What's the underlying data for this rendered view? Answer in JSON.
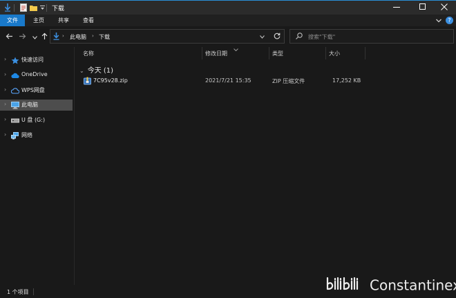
{
  "window": {
    "title": "下载",
    "minimize_icon": "minimize-icon",
    "maximize_icon": "maximize-icon",
    "close_icon": "close-icon"
  },
  "ribbon": {
    "tabs": [
      {
        "label": "文件",
        "active": true
      },
      {
        "label": "主页",
        "active": false
      },
      {
        "label": "共享",
        "active": false
      },
      {
        "label": "查看",
        "active": false
      }
    ]
  },
  "address": {
    "crumbs": [
      "此电脑",
      "下载"
    ],
    "search_placeholder": "搜索\"下载\""
  },
  "sidebar": {
    "items": [
      {
        "label": "快速访问",
        "icon": "star-icon"
      },
      {
        "label": "OneDrive",
        "icon": "cloud-icon"
      },
      {
        "label": "WPS网盘",
        "icon": "cloud-outline-icon"
      },
      {
        "label": "此电脑",
        "icon": "computer-icon",
        "selected": true
      },
      {
        "label": "U 盘 (G:)",
        "icon": "usb-drive-icon"
      },
      {
        "label": "网络",
        "icon": "network-icon"
      }
    ]
  },
  "columns": {
    "name": "名称",
    "modified": "修改日期",
    "type": "类型",
    "size": "大小"
  },
  "group": {
    "label": "今天 (1)"
  },
  "files": [
    {
      "name": "7C95v28.zip",
      "modified": "2021/7/21 15:35",
      "type": "ZIP 压缩文件",
      "size": "17,252 KB",
      "icon": "zip-file-icon"
    }
  ],
  "status": {
    "item_count": "1 个项目"
  },
  "watermark": {
    "text": "Constantinex"
  },
  "colors": {
    "accent": "#1979ca",
    "background": "#191919",
    "selected": "#4d4d4d"
  }
}
